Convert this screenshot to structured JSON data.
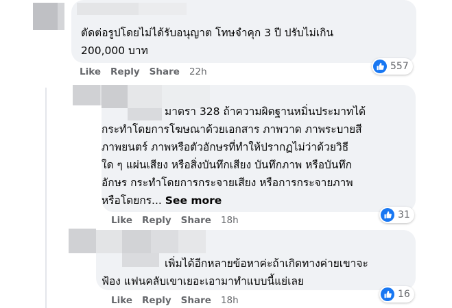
{
  "colors": {
    "bubble": "#f0f2f5",
    "meta": "#65676b",
    "like_blue": "#1877f2"
  },
  "comments": [
    {
      "text_line1": "ตัดต่อรูปโดยไม่ได้รับอนุญาต โทษจำคุก 3 ปี ปรับไม่เกิน",
      "text_line2": "200,000 บาท",
      "actions": {
        "like": "Like",
        "reply": "Reply",
        "share": "Share",
        "time": "22h"
      },
      "reaction": {
        "icon": "thumbs-up-icon",
        "count": "557"
      }
    },
    {
      "text_lines": [
        "มาตรา 328 ถ้าความผิดฐานหมิ่นประมาทได้",
        "กระทำโดยการโฆษณาด้วยเอกสาร ภาพวาด ภาพระบายสี",
        "ภาพยนตร์ ภาพหรือตัวอักษรที่ทำให้ปรากฏไม่ว่าด้วยวิธี",
        "ใด ๆ แผ่นเสียง หรือสิ่งบันทึกเสียง บันทึกภาพ หรือบันทึก",
        "อักษร กระทำโดยการกระจายเสียง หรือการกระจายภาพ"
      ],
      "text_last": "หรือโดยกร...",
      "see_more": "See more",
      "actions": {
        "like": "Like",
        "reply": "Reply",
        "share": "Share",
        "time": "18h"
      },
      "reaction": {
        "icon": "thumbs-up-icon",
        "count": "31"
      }
    },
    {
      "text_line1": "เพิ่มได้อีกหลายข้อหาค่ะถ้าเกิดทางค่ายเขาจะ",
      "text_line2": "ฟ้อง แฟนคลับเขาเยอะเอามาทำแบบนี้แย่เลย",
      "actions": {
        "like": "Like",
        "reply": "Reply",
        "share": "Share",
        "time": "18h"
      },
      "reaction": {
        "icon": "thumbs-up-icon",
        "count": "16"
      }
    }
  ]
}
